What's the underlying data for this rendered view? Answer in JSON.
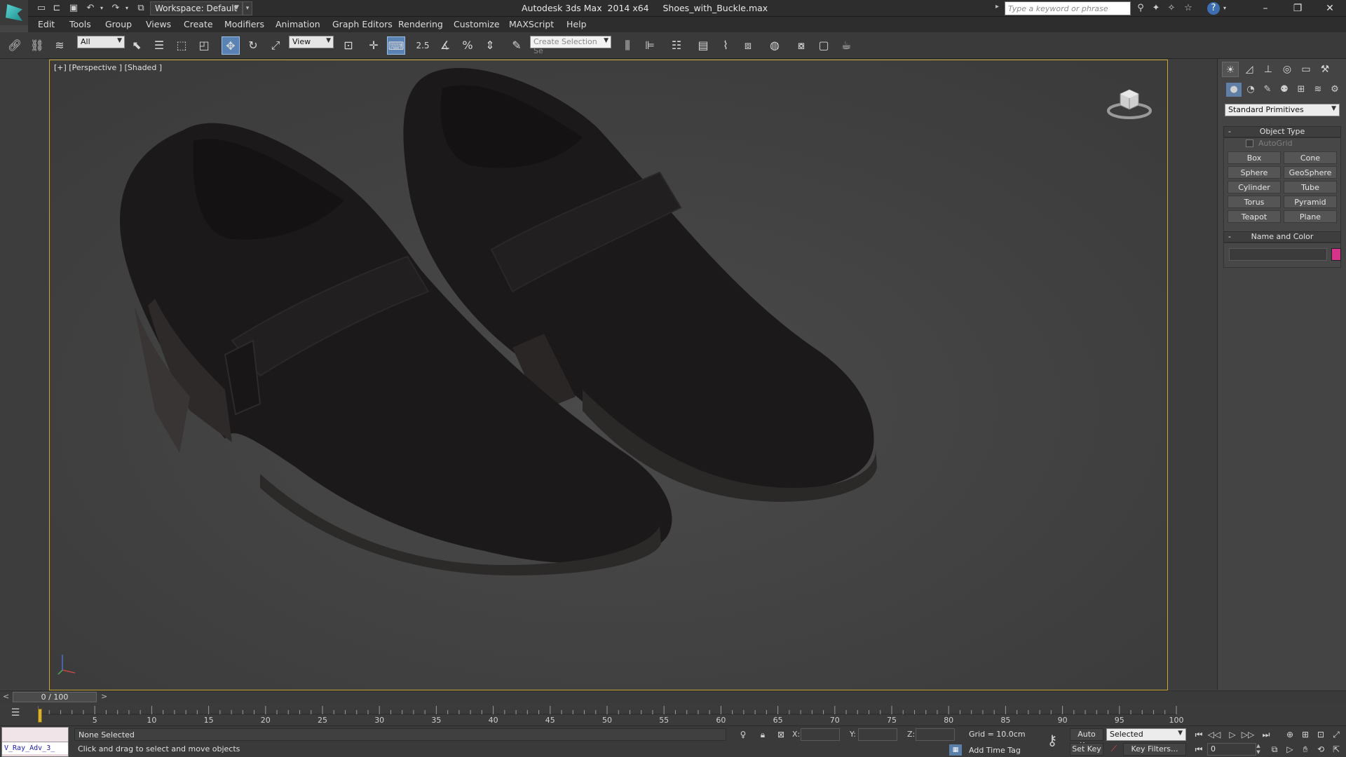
{
  "titlebar": {
    "workspace": "Workspace: Default",
    "app_title": "Autodesk 3ds Max  2014 x64     Shoes_with_Buckle.max",
    "search_placeholder": "Type a keyword or phrase"
  },
  "menu": [
    "Edit",
    "Tools",
    "Group",
    "Views",
    "Create",
    "Modifiers",
    "Animation",
    "Graph Editors",
    "Rendering",
    "Customize",
    "MAXScript",
    "Help"
  ],
  "toolbar": {
    "selection_filter": "All",
    "ref_coord": "View",
    "snap_label": "2.5",
    "selection_set_placeholder": "Create Selection Se"
  },
  "viewport": {
    "label": "[+] [Perspective ] [Shaded ]",
    "background": "#414141",
    "border_color": "#c8a832"
  },
  "command_panel": {
    "category": "Standard Primitives",
    "object_type": {
      "title": "Object Type",
      "autogrid": "AutoGrid",
      "buttons": [
        "Box",
        "Cone",
        "Sphere",
        "GeoSphere",
        "Cylinder",
        "Tube",
        "Torus",
        "Pyramid",
        "Teapot",
        "Plane"
      ]
    },
    "name_and_color": {
      "title": "Name and Color",
      "color": "#d6338a"
    }
  },
  "timeline": {
    "frame_display": "0 / 100",
    "prev": "<",
    "next": ">",
    "ticks": [
      "5",
      "10",
      "15",
      "20",
      "25",
      "30",
      "35",
      "40",
      "45",
      "50",
      "55",
      "60",
      "65",
      "70",
      "75",
      "80",
      "85",
      "90",
      "95",
      "100"
    ]
  },
  "status": {
    "maxscript_text": "V_Ray_Adv_3_",
    "selection": "None Selected",
    "prompt": "Click and drag to select and move objects",
    "x_label": "X:",
    "y_label": "Y:",
    "z_label": "Z:",
    "grid": "Grid = 10.0cm",
    "add_time_tag": "Add Time Tag",
    "auto_key": "Auto Key",
    "set_key": "Set Key",
    "selected": "Selected",
    "key_filters": "Key Filters...",
    "current_frame": "0"
  }
}
